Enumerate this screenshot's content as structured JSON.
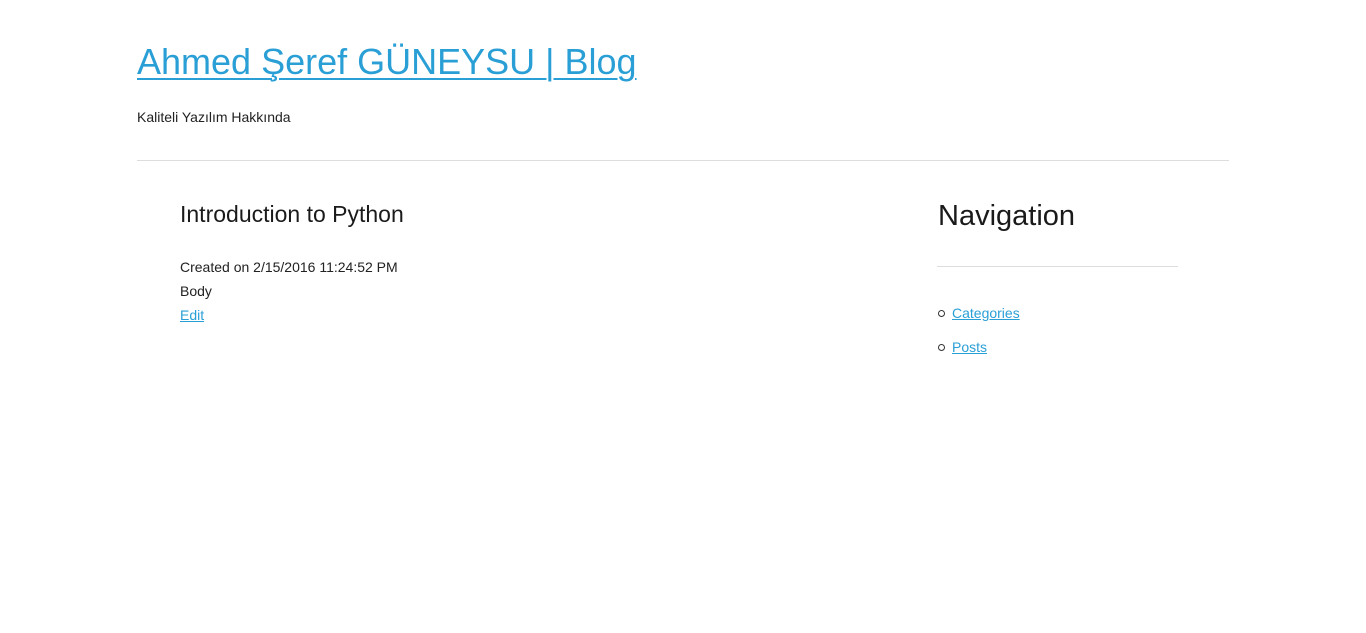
{
  "header": {
    "title": "Ahmed Şeref GÜNEYSU | Blog",
    "tagline": "Kaliteli Yazılım Hakkında"
  },
  "post": {
    "title": "Introduction to Python",
    "created": "Created on 2/15/2016 11:24:52 PM",
    "body": "Body",
    "edit_label": "Edit"
  },
  "sidebar": {
    "title": "Navigation",
    "items": [
      {
        "label": "Categories"
      },
      {
        "label": "Posts"
      }
    ]
  },
  "colors": {
    "link": "#2a9fd6",
    "text": "#333333",
    "divider": "#dddddd"
  }
}
